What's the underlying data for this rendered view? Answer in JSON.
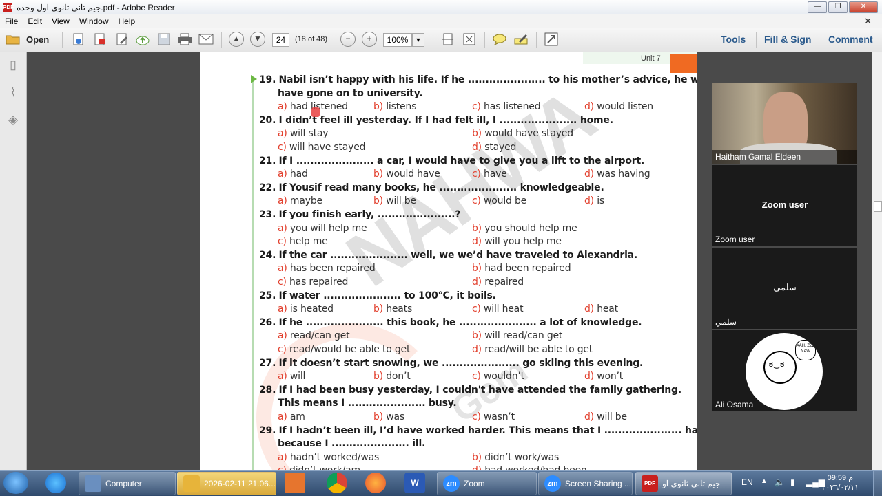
{
  "window": {
    "title": "جيم تاني ثانوي اول وحده.pdf - Adobe Reader",
    "min": "—",
    "max": "❐",
    "close": "✕"
  },
  "menu": [
    "File",
    "Edit",
    "View",
    "Window",
    "Help"
  ],
  "toolbar": {
    "open_label": "Open",
    "page_current": "24",
    "page_info": "(18 of 48)",
    "zoom_value": "100%",
    "tools": "Tools",
    "fill_sign": "Fill & Sign",
    "comment": "Comment"
  },
  "page": {
    "unit_label": "Unit 7",
    "watermark": "NAHWA",
    "watermark2": "Gem"
  },
  "questions": [
    {
      "num": "19.",
      "lines": [
        "Nabil isn’t happy with his life. If he ...................... to his mother’s advice, he would",
        "have gone on to university."
      ],
      "options": [
        [
          "a)",
          "had listened"
        ],
        [
          "b)",
          "listens"
        ],
        [
          "c)",
          "has listened"
        ],
        [
          "d)",
          "would listen"
        ]
      ]
    },
    {
      "num": "20.",
      "lines": [
        "I didn’t feel ill yesterday. If I had felt ill, I ...................... home."
      ],
      "options": [
        [
          "a)",
          "will stay"
        ],
        [
          "b)",
          "would have stayed"
        ],
        [
          "c)",
          "will have stayed"
        ],
        [
          "d)",
          "stayed"
        ]
      ]
    },
    {
      "num": "21.",
      "lines": [
        "If I ...................... a car, I would have to give you a lift to the airport."
      ],
      "options": [
        [
          "a)",
          "had"
        ],
        [
          "b)",
          "would have"
        ],
        [
          "c)",
          "have"
        ],
        [
          "d)",
          "was having"
        ]
      ]
    },
    {
      "num": "22.",
      "lines": [
        "If Yousif read many books, he ...................... knowledgeable."
      ],
      "options": [
        [
          "a)",
          "maybe"
        ],
        [
          "b)",
          "will be"
        ],
        [
          "c)",
          "would be"
        ],
        [
          "d)",
          "is"
        ]
      ]
    },
    {
      "num": "23.",
      "lines": [
        "If you finish early, ......................?"
      ],
      "options": [
        [
          "a)",
          "you will help me"
        ],
        [
          "b)",
          "you should help me"
        ],
        [
          "c)",
          "help me"
        ],
        [
          "d)",
          "will you help me"
        ]
      ]
    },
    {
      "num": "24.",
      "lines": [
        "If the car ...................... well, we we’d have traveled to Alexandria."
      ],
      "options": [
        [
          "a)",
          "has been repaired"
        ],
        [
          "b)",
          "had been repaired"
        ],
        [
          "c)",
          "has repaired"
        ],
        [
          "d)",
          "repaired"
        ]
      ]
    },
    {
      "num": "25.",
      "lines": [
        "If water ...................... to 100°C, it boils."
      ],
      "options": [
        [
          "a)",
          "is heated"
        ],
        [
          "b)",
          "heats"
        ],
        [
          "c)",
          "will heat"
        ],
        [
          "d)",
          "heat"
        ]
      ]
    },
    {
      "num": "26.",
      "lines": [
        "If he ...................... this book, he ...................... a lot of knowledge."
      ],
      "options": [
        [
          "a)",
          "read/can get"
        ],
        [
          "b)",
          "will read/can get"
        ],
        [
          "c)",
          "read/would be able to get"
        ],
        [
          "d)",
          "read/will be able to get"
        ]
      ]
    },
    {
      "num": "27.",
      "lines": [
        "If it doesn’t start snowing, we ...................... go skiing this evening."
      ],
      "options": [
        [
          "a)",
          "will"
        ],
        [
          "b)",
          "don’t"
        ],
        [
          "c)",
          "wouldn’t"
        ],
        [
          "d)",
          "won’t"
        ]
      ]
    },
    {
      "num": "28.",
      "lines": [
        "If I had been busy yesterday, I couldn't have attended the family gathering.",
        "This means I ...................... busy."
      ],
      "options": [
        [
          "a)",
          "am"
        ],
        [
          "b)",
          "was"
        ],
        [
          "c)",
          "wasn’t"
        ],
        [
          "d)",
          "will be"
        ]
      ]
    },
    {
      "num": "29.",
      "lines": [
        "If I hadn’t been ill, I’d have worked harder. This means that I ...................... harder",
        "because I ...................... ill."
      ],
      "options": [
        [
          "a)",
          "hadn’t worked/was"
        ],
        [
          "b)",
          "didn’t work/was"
        ],
        [
          "c)",
          "didn’t work/am"
        ],
        [
          "d)",
          "had worked/had been"
        ]
      ]
    }
  ],
  "zoom_panel": {
    "participants": [
      {
        "name": "Haitham Gamal Eldeen",
        "center": ""
      },
      {
        "name": "Zoom user",
        "center": "Zoom user"
      },
      {
        "name": "سلمي",
        "center": "سلمي"
      },
      {
        "name": "Ali Osama",
        "center": ""
      }
    ],
    "avatar_text": "AAH, ZZZ NAW"
  },
  "taskbar": {
    "computer": "Computer",
    "folder": "2026-02-11 21.06...",
    "word_icon": "W",
    "zoom": "Zoom",
    "screen_sharing": "Screen Sharing ...",
    "pdf": "جيم تاني ثانوي او",
    "lang": "EN",
    "time": "09:59 م",
    "date": "٢٠٢٦/٠٢/١١"
  }
}
